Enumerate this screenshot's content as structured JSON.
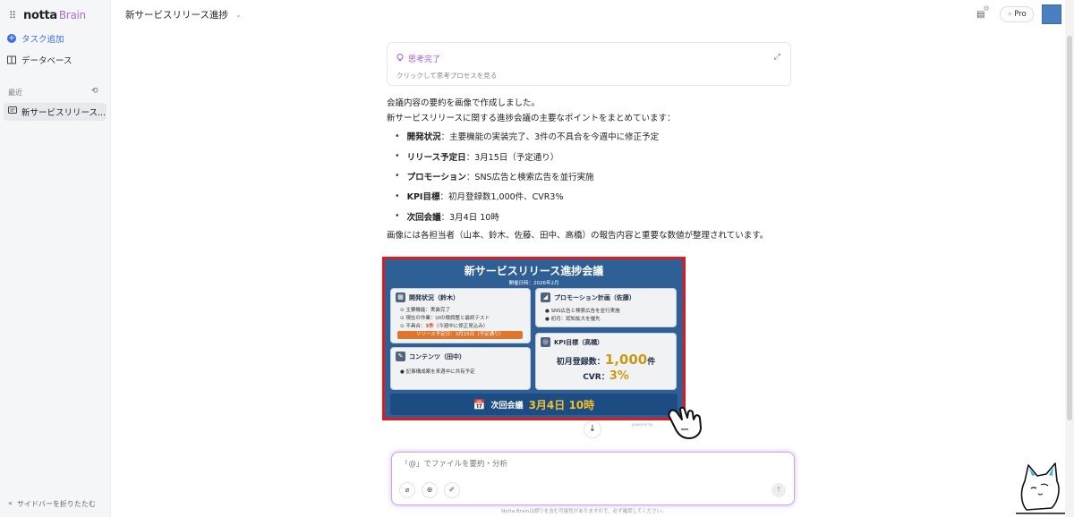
{
  "app": {
    "logo": "notta",
    "logo_suffix": "Brain"
  },
  "sidebar": {
    "add_task": "タスク追加",
    "database": "データベース",
    "recent_label": "最近",
    "recent_items": [
      "新サービスリリース..."
    ],
    "collapse": "サイドバーを折りたたむ"
  },
  "header": {
    "title": "新サービスリリース進捗",
    "badge": "1",
    "pro": "Pro"
  },
  "thinking": {
    "title": "思考完了",
    "subtitle": "クリックして思考プロセスを見る"
  },
  "message": {
    "line1": "会議内容の要約を画像で作成しました。",
    "line2": "新サービスリリースに関する進捗会議の主要なポイントをまとめています：",
    "bullets": [
      {
        "label": "開発状況",
        "text": "：主要機能の実装完了、3件の不具合を今週中に修正予定"
      },
      {
        "label": "リリース予定日",
        "text": "：3月15日（予定通り）"
      },
      {
        "label": "プロモーション",
        "text": "：SNS広告と検索広告を並行実施"
      },
      {
        "label": "KPI目標",
        "text": "：初月登録数1,000件、CVR3%"
      },
      {
        "label": "次回会議",
        "text": "：3月4日 10時"
      }
    ],
    "tail": "画像には各担当者（山本、鈴木、佐藤、田中、高橋）の報告内容と重要な数値が整理されています。"
  },
  "infographic": {
    "title": "新サービスリリース進捗会議",
    "date": "開催日時：2026年2月",
    "dev": {
      "heading": "開発状況（鈴木）",
      "l1": "主要機能：実装完了",
      "l2": "現在の作業：UIの微調整と最終テスト",
      "l3_prefix": "不具合：",
      "l3_red": "3件",
      "l3_suffix": "（今週中に修正見込み）",
      "release": "リリース予定日：3月15日（予定通り）"
    },
    "content": {
      "heading": "コンテンツ（田中）",
      "l1": "記事構成案を来週中に共有予定"
    },
    "promo": {
      "heading": "プロモーション計画（佐藤）",
      "l1": "SNS広告と検索広告を並行実施",
      "l2": "初月：認知拡大を優先"
    },
    "kpi": {
      "heading": "KPI目標（高橋）",
      "reg_label": "初月登録数：",
      "reg_value": "1,000",
      "reg_unit": "件",
      "cvr_label": "CVR：",
      "cvr_value": "3%"
    },
    "next": {
      "label": "次回会議",
      "value": "3月4日 10時"
    },
    "powered": "powered by"
  },
  "input": {
    "placeholder": "「@」でファイルを要約・分析"
  },
  "disclaimer": "Notta Brainは誤りを含む可能性がありますので、必ず確認してください。"
}
